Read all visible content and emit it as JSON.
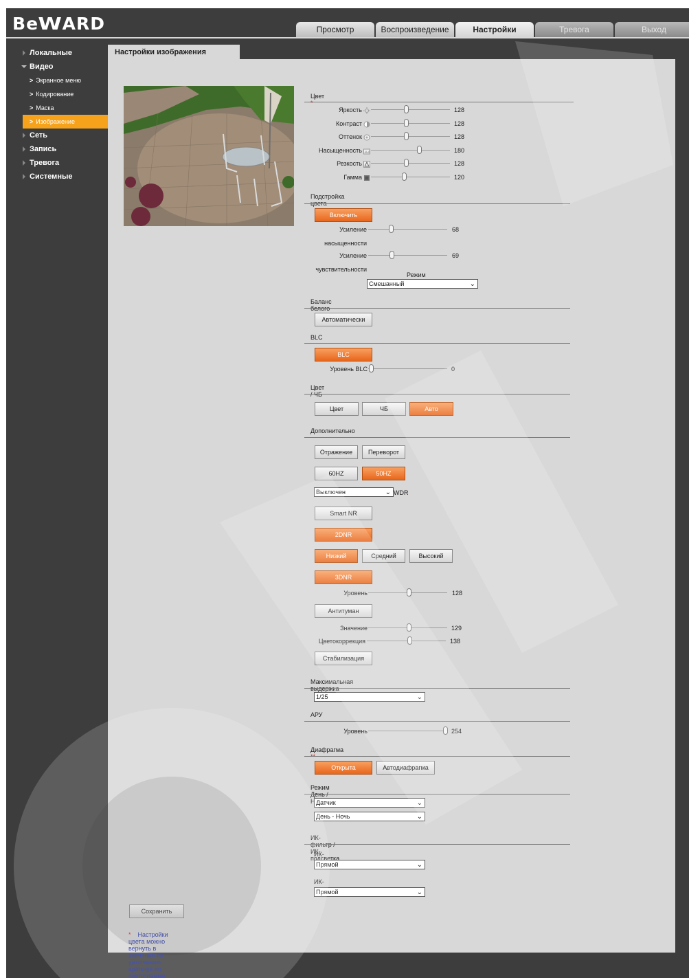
{
  "logo": "BEWARD",
  "tabs": [
    "Просмотр",
    "Воспроизведение",
    "Настройки",
    "Тревога",
    "Выход"
  ],
  "menu": {
    "local": "Локальные",
    "video": "Видео",
    "subs": [
      "Экранное меню",
      "Кодирование",
      "Маска",
      "Изображение"
    ],
    "network": "Сеть",
    "record": "Запись",
    "alarm": "Тревога",
    "system": "Системные"
  },
  "page_title": "Настройки изображения",
  "color": {
    "title": "Цвет",
    "star": "*",
    "sliders": [
      {
        "label": "Яркость",
        "value": "128",
        "icon": "brightness-icon",
        "frac": 0.5
      },
      {
        "label": "Контраст",
        "value": "128",
        "icon": "contrast-icon",
        "frac": 0.5
      },
      {
        "label": "Оттенок",
        "value": "128",
        "icon": "hue-icon",
        "frac": 0.5
      },
      {
        "label": "Насыщенность",
        "value": "180",
        "icon": "saturation-icon",
        "frac": 0.7
      },
      {
        "label": "Резкость",
        "value": "128",
        "icon": "sharpness-icon",
        "frac": 0.5
      },
      {
        "label": "Гамма",
        "value": "120",
        "icon": "gamma-icon",
        "frac": 0.47
      }
    ]
  },
  "tune": {
    "title": "Подстройка цвета",
    "enable": "Включить",
    "gain_sat_1": "Усиление",
    "gain_sat_2": "насыщенности",
    "gain_sat_value": "68",
    "gain_sens_1": "Усиление",
    "gain_sens_2": "чувствительности",
    "gain_sens_value": "69",
    "mode_label": "Режим цвета",
    "mode_value": "Смешанный"
  },
  "wb": {
    "title": "Баланс белого",
    "auto": "Автоматически"
  },
  "blc": {
    "title": "BLC",
    "button": "BLC",
    "level_label": "Уровень BLC",
    "level_value": "0"
  },
  "bw": {
    "title": "Цвет / ЧБ",
    "color": "Цвет",
    "bw": "ЧБ",
    "auto": "Авто"
  },
  "extra": {
    "title": "Дополнительно",
    "mirror": "Отражение",
    "flip": "Переворот",
    "hz60": "60HZ",
    "hz50": "50HZ",
    "wdr_value": "Выключен",
    "wdr_label": "WDR",
    "smartnr": "Smart NR",
    "dnr2": "2DNR",
    "low": "Низкий",
    "mid": "Средний",
    "high": "Высокий",
    "dnr3": "3DNR",
    "level_label": "Уровень",
    "level_value": "128",
    "defog": "Антитуман",
    "value_label": "Значение",
    "value_value": "129",
    "cc_label": "Цветокоррекция",
    "cc_value": "138",
    "stab": "Стабилизация"
  },
  "shutter": {
    "title": "Максимальная выдержка",
    "value": "1/25"
  },
  "agc": {
    "title": "АРУ",
    "level_label": "Уровень",
    "level_value": "254"
  },
  "iris": {
    "title": "Диафрагма",
    "star": "**",
    "open": "Открыта",
    "auto": "Автодиафрагма"
  },
  "daynight": {
    "title": "Режим День / Ночь",
    "sel1": "Датчик",
    "sel2": "День - Ночь"
  },
  "ir": {
    "title": "ИК-фильтр / ИК-подсветка",
    "filter_label": "ИК-фильтр",
    "filter_value": "Прямой",
    "light_label": "ИК-подсветка",
    "light_value": "Прямой"
  },
  "save": "Сохранить",
  "note_star": "*",
  "note": "Настройки цвета можно вернуть в значения по умолчанию, щелкнув по пиктограмме параметра."
}
